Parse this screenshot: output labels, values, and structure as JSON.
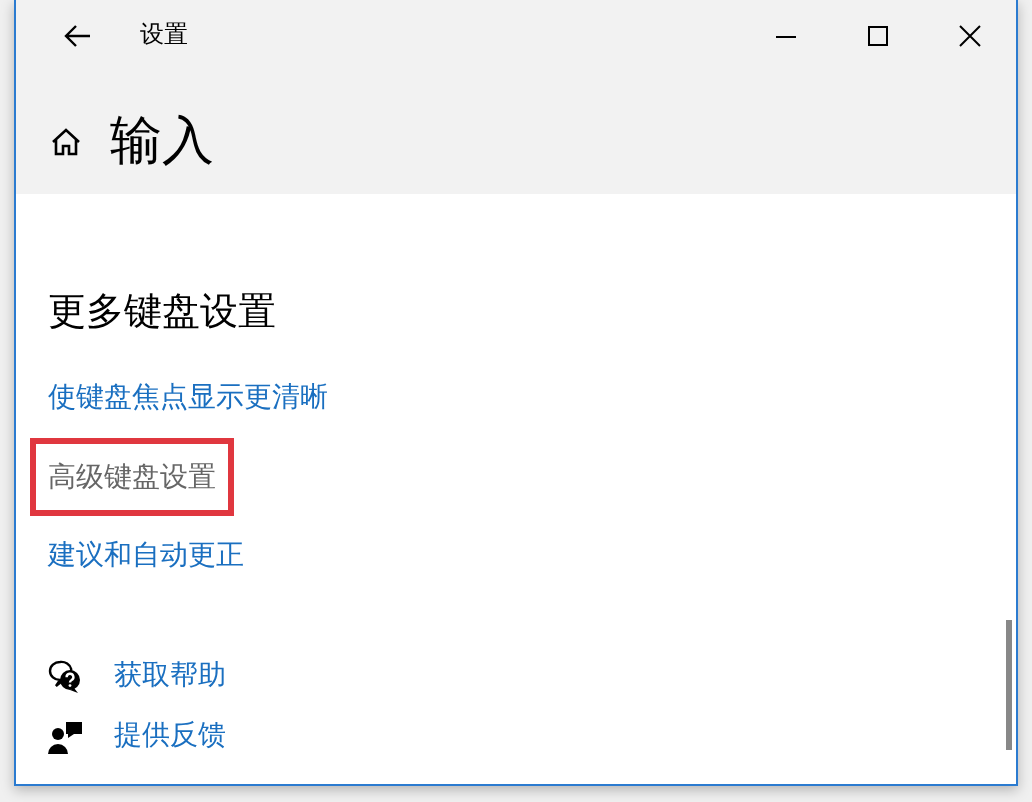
{
  "window": {
    "title": "设置"
  },
  "header": {
    "title": "输入"
  },
  "section": {
    "heading": "更多键盘设置",
    "links": [
      {
        "label": "使键盘焦点显示更清晰",
        "kind": "link",
        "highlighted": false
      },
      {
        "label": "高级键盘设置",
        "kind": "text",
        "highlighted": true
      },
      {
        "label": "建议和自动更正",
        "kind": "link",
        "highlighted": false
      }
    ]
  },
  "help_links": [
    {
      "label": "获取帮助",
      "kind": "help"
    },
    {
      "label": "提供反馈",
      "kind": "feedback"
    }
  ]
}
